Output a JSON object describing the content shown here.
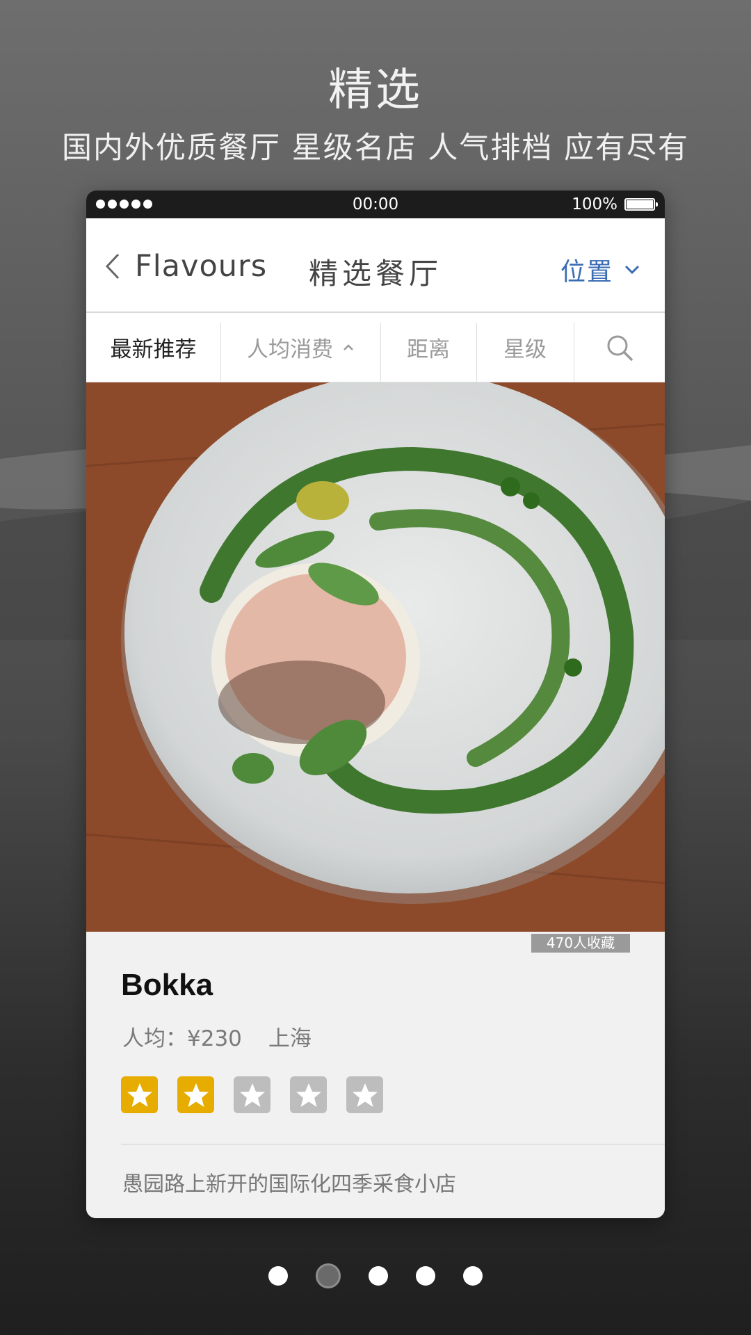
{
  "promo": {
    "title": "精选",
    "subtitle": "国内外优质餐厅 星级名店 人气排档 应有尽有"
  },
  "statusbar": {
    "time": "00:00",
    "battery": "100%"
  },
  "navbar": {
    "back_label": "Flavours",
    "title": "精选餐厅",
    "location_label": "位置"
  },
  "filters": [
    {
      "label": "最新推荐",
      "active": true
    },
    {
      "label": "人均消费",
      "active": false
    },
    {
      "label": "距离",
      "active": false
    },
    {
      "label": "星级",
      "active": false
    }
  ],
  "restaurant": {
    "favorites": "470人收藏",
    "name": "Bokka",
    "price": "人均：¥230",
    "city": "上海",
    "rating": 2,
    "rating_max": 5,
    "description": "愚园路上新开的国际化四季采食小店"
  },
  "pagination": {
    "total": 5,
    "current": 2
  },
  "colors": {
    "accent": "#3a6cb4",
    "star_on": "#e6ad00",
    "star_off": "#bdbdbd"
  }
}
